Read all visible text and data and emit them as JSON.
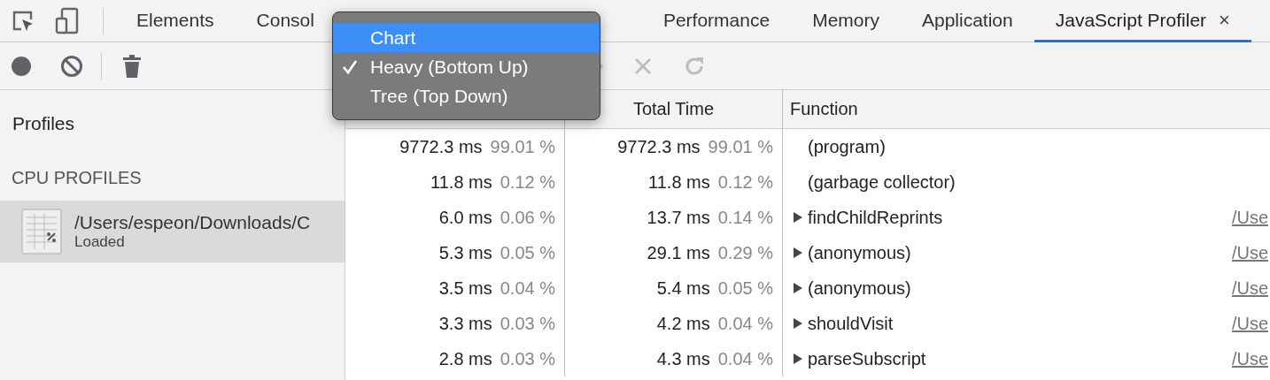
{
  "tabs": [
    {
      "label": "Elements",
      "selected": false
    },
    {
      "label": "Consol",
      "selected": false
    },
    {
      "label": "Performance",
      "selected": false
    },
    {
      "label": "Memory",
      "selected": false
    },
    {
      "label": "Application",
      "selected": false
    },
    {
      "label": "JavaScript Profiler",
      "selected": true,
      "close": "×"
    }
  ],
  "sidebar": {
    "title": "Profiles",
    "section": "CPU PROFILES",
    "items": [
      {
        "name": "/Users/espeon/Downloads/C",
        "status": "Loaded",
        "selected": true
      }
    ]
  },
  "table": {
    "columns": [
      "Total Time",
      "Function"
    ],
    "rows": [
      {
        "self_time": "9772.3 ms",
        "self_percent": "99.01 %",
        "total_time": "9772.3 ms",
        "total_percent": "99.01 %",
        "function": "(program)",
        "expandable": false
      },
      {
        "self_time": "11.8 ms",
        "self_percent": "0.12 %",
        "total_time": "11.8 ms",
        "total_percent": "0.12 %",
        "function": "(garbage collector)",
        "expandable": false
      },
      {
        "self_time": "6.0 ms",
        "self_percent": "0.06 %",
        "total_time": "13.7 ms",
        "total_percent": "0.14 %",
        "function": "findChildReprints",
        "expandable": true,
        "url": "/Use"
      },
      {
        "self_time": "5.3 ms",
        "self_percent": "0.05 %",
        "total_time": "29.1 ms",
        "total_percent": "0.29 %",
        "function": "(anonymous)",
        "expandable": true,
        "url": "/Use"
      },
      {
        "self_time": "3.5 ms",
        "self_percent": "0.04 %",
        "total_time": "5.4 ms",
        "total_percent": "0.05 %",
        "function": "(anonymous)",
        "expandable": true,
        "url": "/Use"
      },
      {
        "self_time": "3.3 ms",
        "self_percent": "0.03 %",
        "total_time": "4.2 ms",
        "total_percent": "0.04 %",
        "function": "shouldVisit",
        "expandable": true,
        "url": "/Use"
      },
      {
        "self_time": "2.8 ms",
        "self_percent": "0.03 %",
        "total_time": "4.3 ms",
        "total_percent": "0.04 %",
        "function": "parseSubscript",
        "expandable": true,
        "url": "/Use"
      }
    ]
  },
  "view_menu": {
    "items": [
      {
        "label": "Chart",
        "selected": true,
        "checked": false
      },
      {
        "label": "Heavy (Bottom Up)",
        "selected": false,
        "checked": true
      },
      {
        "label": "Tree (Top Down)",
        "selected": false,
        "checked": false
      }
    ]
  }
}
